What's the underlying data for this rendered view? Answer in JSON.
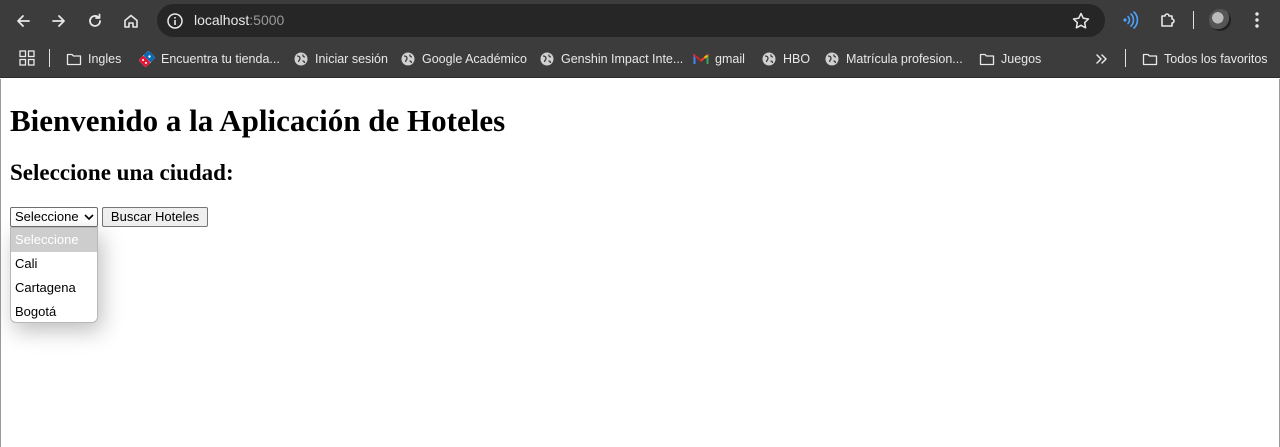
{
  "browser": {
    "url_host": "localhost",
    "url_port": ":5000"
  },
  "bookmarks": [
    {
      "label": "Ingles",
      "icon": "folder-icon"
    },
    {
      "label": "Encuentra tu tienda...",
      "icon": "dominos-icon"
    },
    {
      "label": "Iniciar sesión",
      "icon": "globe-icon"
    },
    {
      "label": "Google Académico",
      "icon": "globe-icon"
    },
    {
      "label": "Genshin Impact Inte...",
      "icon": "globe-icon"
    },
    {
      "label": "gmail",
      "icon": "gmail-icon"
    },
    {
      "label": "HBO",
      "icon": "globe-icon"
    },
    {
      "label": "Matrícula profesion...",
      "icon": "globe-icon"
    },
    {
      "label": "Juegos",
      "icon": "folder-icon"
    }
  ],
  "all_bookmarks_label": "Todos los favoritos",
  "page": {
    "title": "Bienvenido a la Aplicación de Hoteles",
    "subtitle": "Seleccione una ciudad:",
    "select_value": "Seleccione",
    "search_button": "Buscar Hoteles",
    "options": [
      "Seleccione",
      "Cali",
      "Cartagena",
      "Bogotá"
    ]
  },
  "colors": {
    "chrome_bg": "#3c3c3c",
    "omnibox_bg": "#262626",
    "option_highlight": "#cdcdcd"
  }
}
